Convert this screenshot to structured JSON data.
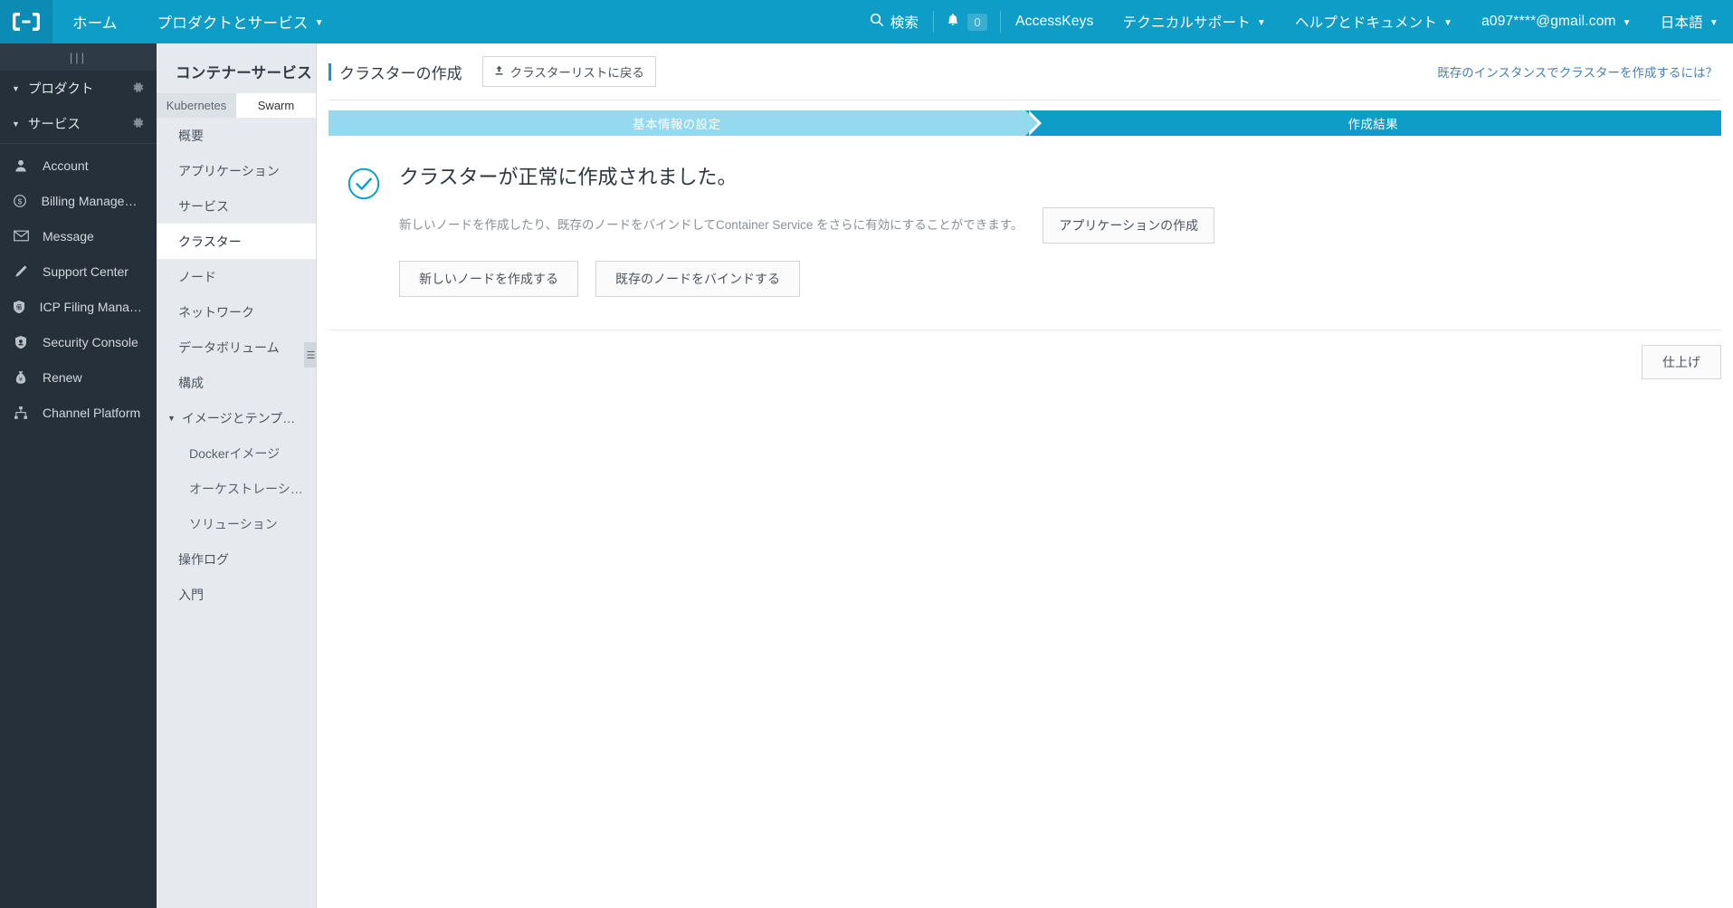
{
  "header": {
    "logo_icon": "alibaba-cloud-logo-icon",
    "left_nav": [
      {
        "label": "ホーム",
        "caret": false
      },
      {
        "label": "プロダクトとサービス",
        "caret": true
      }
    ],
    "search_label": "検索",
    "search_icon": "search-icon",
    "bell_icon": "bell-icon",
    "notification_count": "0",
    "right_nav": [
      {
        "label": "AccessKeys",
        "caret": false
      },
      {
        "label": "テクニカルサポート",
        "caret": true
      },
      {
        "label": "ヘルプとドキュメント",
        "caret": true
      },
      {
        "label": "a097****@gmail.com",
        "caret": true
      },
      {
        "label": "日本語",
        "caret": true
      }
    ]
  },
  "sidebar": {
    "handle_icon": "collapse-handle-icon",
    "groups": [
      {
        "label": "プロダクト",
        "gear_icon": "gear-icon",
        "tri_icon": "chevron-down-icon"
      },
      {
        "label": "サービス",
        "gear_icon": "gear-icon",
        "tri_icon": "chevron-down-icon"
      }
    ],
    "items": [
      {
        "label": "Account",
        "icon": "user-icon"
      },
      {
        "label": "Billing Management",
        "icon": "dollar-circle-icon"
      },
      {
        "label": "Message",
        "icon": "envelope-icon"
      },
      {
        "label": "Support Center",
        "icon": "pencil-icon"
      },
      {
        "label": "ICP Filing Managem…",
        "icon": "shield-record-icon"
      },
      {
        "label": "Security Console",
        "icon": "shield-icon"
      },
      {
        "label": "Renew",
        "icon": "money-bag-icon"
      },
      {
        "label": "Channel Platform",
        "icon": "network-node-icon"
      }
    ]
  },
  "subnav": {
    "title": "コンテナーサービス",
    "tabs": [
      {
        "label": "Kubernetes",
        "active": false
      },
      {
        "label": "Swarm",
        "active": true
      }
    ],
    "items": [
      {
        "label": "概要",
        "type": "item",
        "active": false
      },
      {
        "label": "アプリケーション",
        "type": "item",
        "active": false
      },
      {
        "label": "サービス",
        "type": "item",
        "active": false
      },
      {
        "label": "クラスター",
        "type": "item",
        "active": true
      },
      {
        "label": "ノード",
        "type": "item",
        "active": false
      },
      {
        "label": "ネットワーク",
        "type": "item",
        "active": false
      },
      {
        "label": "データボリューム",
        "type": "item",
        "active": false
      },
      {
        "label": "構成",
        "type": "item",
        "active": false
      },
      {
        "label": "イメージとテンプレート",
        "type": "group",
        "active": false
      },
      {
        "label": "Dockerイメージ",
        "type": "child",
        "active": false
      },
      {
        "label": "オーケストレーショ…",
        "type": "child",
        "active": false
      },
      {
        "label": "ソリューション",
        "type": "child",
        "active": false
      },
      {
        "label": "操作ログ",
        "type": "item",
        "active": false
      },
      {
        "label": "入門",
        "type": "item",
        "active": false
      }
    ],
    "collapse_icon": "collapse-panel-icon"
  },
  "main": {
    "breadcrumb_title": "クラスターの作成",
    "back_button": "クラスターリストに戻る",
    "back_button_icon": "upload-arrow-icon",
    "help_link": "既存のインスタンスでクラスターを作成するには？",
    "steps": [
      {
        "label": "基本情報の設定",
        "state": "done"
      },
      {
        "label": "作成結果",
        "state": "current"
      }
    ],
    "success_icon": "check-circle-icon",
    "success_title": "クラスターが正常に作成されました。",
    "success_desc": "新しいノードを作成したり、既存のノードをバインドしてContainer Service をさらに有効にすることができます。",
    "create_app_button": "アプリケーションの作成",
    "actions": [
      {
        "label": "新しいノードを作成する"
      },
      {
        "label": "既存のノードをバインドする"
      }
    ],
    "finish_button": "仕上げ"
  },
  "colors": {
    "brand": "#0d9dc7",
    "brand_dark": "#0a8cb4",
    "step_done": "#95d9ef",
    "sidebar_bg": "#25303b",
    "subnav_bg": "#e6eaee",
    "link": "#4a7fb5"
  }
}
